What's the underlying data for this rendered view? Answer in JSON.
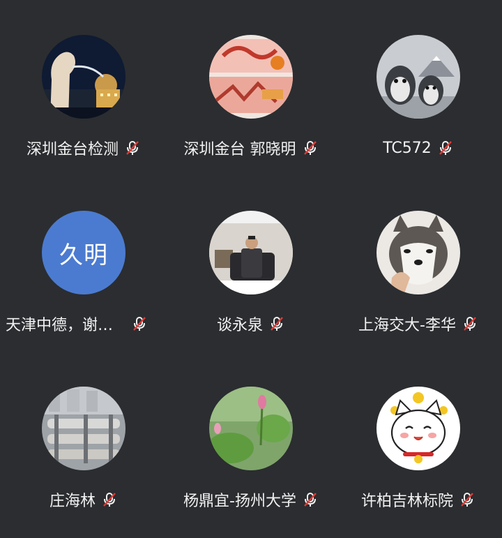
{
  "participants": [
    {
      "name": "深圳金台检测",
      "avatar": "merlion-night-photo",
      "muted": true
    },
    {
      "name": "深圳金台 郭晓明",
      "avatar": "commemorative-banknote-photo",
      "muted": true
    },
    {
      "name": "TC572",
      "avatar": "penguins-photo",
      "muted": true
    },
    {
      "name": "天津中德，谢…",
      "avatar_text": "久明",
      "avatar_color": "#4b7bd0",
      "muted": true
    },
    {
      "name": "谈永泉",
      "avatar": "man-seated-office-photo",
      "muted": true
    },
    {
      "name": "上海交大-李华",
      "avatar": "husky-dog-photo",
      "muted": true
    },
    {
      "name": "庄海林",
      "avatar": "factory-machinery-photo",
      "muted": true
    },
    {
      "name": "杨鼎宜-扬州大学",
      "avatar": "lotus-pond-photo",
      "muted": true
    },
    {
      "name": "许柏吉林标院",
      "avatar": "lucky-cat-cartoon",
      "muted": true
    }
  ],
  "colors": {
    "background": "#2b2d30",
    "mute_icon_strike": "#e53935",
    "text": "#f2f2f2"
  }
}
